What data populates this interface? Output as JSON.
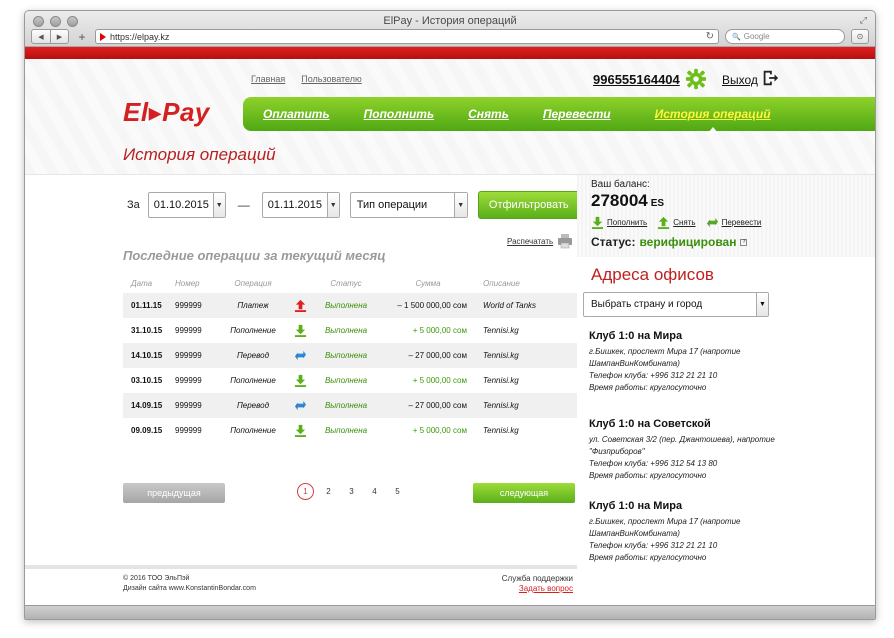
{
  "browser": {
    "window_title": "ElPay - История операций",
    "url": "https://elpay.kz",
    "search_placeholder": "Google",
    "back": "◀",
    "forward": "▶",
    "new_tab": "+",
    "reload": "↻",
    "search_glyph": "🔍"
  },
  "header": {
    "logo": "El▸Pay",
    "links": [
      "Главная",
      "Пользователю"
    ],
    "phone": "996555164404",
    "logout": "Выход",
    "nav": [
      "Оплатить",
      "Пополнить",
      "Снять",
      "Перевести",
      "История операций"
    ],
    "active_nav_index": 4,
    "page_title": "История операций"
  },
  "filter": {
    "label_from": "За",
    "date_from": "01.10.2015",
    "dash": "—",
    "date_to": "01.11.2015",
    "type": "Тип операции",
    "button": "Отфильтровать",
    "print": "Распечатать"
  },
  "recent_title": "Последние операции за текущий месяц",
  "table": {
    "headers": [
      "Дата",
      "Номер",
      "Операция",
      "Статус",
      "Сумма",
      "Описание"
    ],
    "rows": [
      {
        "date": "01.11.15",
        "num": "999999",
        "op": "Платеж",
        "icon": "upload-icon",
        "status": "Выполнена",
        "sum": "– 1 500 000,00 сом",
        "desc": "World of Tanks",
        "plus": false
      },
      {
        "date": "31.10.15",
        "num": "999999",
        "op": "Пополнение",
        "icon": "download-icon",
        "status": "Выполнена",
        "sum": "+ 5 000,00 сом",
        "desc": "Tennisi.kg",
        "plus": true
      },
      {
        "date": "14.10.15",
        "num": "999999",
        "op": "Перевод",
        "icon": "transfer-icon",
        "status": "Выполнена",
        "sum": "– 27 000,00 сом",
        "desc": "Tennisi.kg",
        "plus": false
      },
      {
        "date": "03.10.15",
        "num": "999999",
        "op": "Пополнение",
        "icon": "download-icon",
        "status": "Выполнена",
        "sum": "+ 5 000,00 сом",
        "desc": "Tennisi.kg",
        "plus": true
      },
      {
        "date": "14.09.15",
        "num": "999999",
        "op": "Перевод",
        "icon": "transfer-icon",
        "status": "Выполнена",
        "sum": "– 27 000,00 сом",
        "desc": "Tennisi.kg",
        "plus": false
      },
      {
        "date": "09.09.15",
        "num": "999999",
        "op": "Пополнение",
        "icon": "download-icon",
        "status": "Выполнена",
        "sum": "+ 5 000,00 сом",
        "desc": "Tennisi.kg",
        "plus": true
      }
    ]
  },
  "pager": {
    "prev": "предыдущая",
    "next": "следующая",
    "pages": [
      "1",
      "2",
      "3",
      "4",
      "5"
    ],
    "current": "1"
  },
  "footer": {
    "copyright": "© 2016 ТОО ЭльПэй",
    "design": "Дизайн сайта www.KonstantinBondar.com",
    "support": "Служба поддержки",
    "ask": "Задать вопрос"
  },
  "balance": {
    "label": "Ваш баланс:",
    "value": "278004",
    "currency": "ES",
    "actions": [
      "Пополнить",
      "Снять",
      "Перевести"
    ],
    "status_label": "Статус:",
    "status_value": "верифицирован",
    "help": "?"
  },
  "offices": {
    "title": "Адреса офисов",
    "select": "Выбрать страну и город",
    "items": [
      {
        "name": "Клуб 1:0 на Мира",
        "lines": [
          "г.Бишкек, проспект Мира 17 (напротие ШампанВинКомбината)",
          "Телефон клуба: +996 312 21 21 10",
          "Время работы: круглосуточно"
        ]
      },
      {
        "name": "Клуб 1:0 на Советской",
        "lines": [
          "ул. Советская 3/2 (пер. Джантошева), напротие \"Физприборов\"",
          "Телефон клуба: +996 312 54 13 80",
          "Время работы: круглосуточно"
        ]
      },
      {
        "name": "Клуб 1:0 на Мира",
        "lines": [
          "г.Бишкек, проспект Мира 17 (напротие ШампанВинКомбината)",
          "Телефон клуба: +996 312 21 21 10",
          "Время работы: круглосуточно"
        ]
      }
    ]
  },
  "colors": {
    "brand_red": "#d32020",
    "green": "#5aaf1a",
    "active_nav": "#fff73d"
  }
}
